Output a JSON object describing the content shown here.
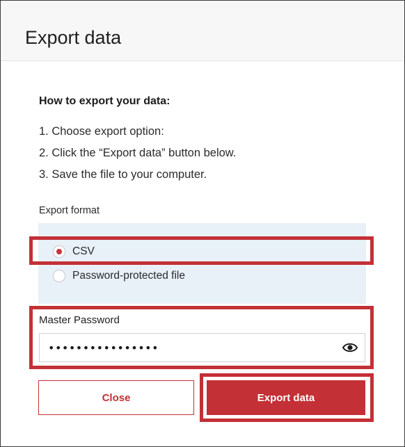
{
  "dialog": {
    "title": "Export data"
  },
  "instructions": {
    "heading": "How to export your data:",
    "steps": [
      "1. Choose export option:",
      "2. Click the “Export data” button below.",
      "3. Save the file to your computer."
    ]
  },
  "export_format": {
    "label": "Export format",
    "options": [
      {
        "label": "CSV",
        "selected": true
      },
      {
        "label": "Password-protected file",
        "selected": false
      }
    ]
  },
  "master_password": {
    "label": "Master Password",
    "value": "••••••••••••••••",
    "toggle_icon": "eye-icon"
  },
  "buttons": {
    "close_label": "Close",
    "export_label": "Export data"
  },
  "colors": {
    "accent": "#c33036",
    "panel_bg": "#e8f0f8",
    "header_bg": "#f7f7f7"
  }
}
